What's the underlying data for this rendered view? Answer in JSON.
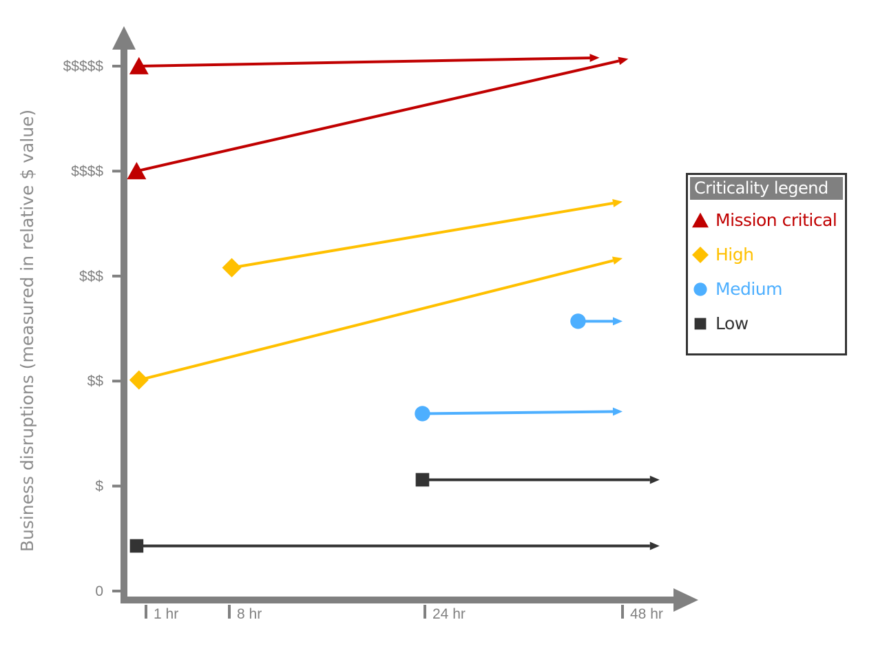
{
  "chart_data": {
    "type": "line",
    "ylabel": "Business disruptions (measured in relative $ value)",
    "x_ticks": [
      {
        "label": "1 hr",
        "value": 1
      },
      {
        "label": "8 hr",
        "value": 8
      },
      {
        "label": "24 hr",
        "value": 24
      },
      {
        "label": "48 hr",
        "value": 48
      }
    ],
    "y_ticks": [
      {
        "label": "0",
        "value": 0
      },
      {
        "label": "$",
        "value": 1
      },
      {
        "label": "$$",
        "value": 2
      },
      {
        "label": "$$$",
        "value": 3
      },
      {
        "label": "$$$$",
        "value": 4
      },
      {
        "label": "$$$$$",
        "value": 5
      }
    ],
    "series": [
      {
        "category": "mission",
        "start": [
          0.7,
          5.0
        ],
        "end": [
          45.2,
          5.08
        ]
      },
      {
        "category": "mission",
        "start": [
          0.6,
          4.0
        ],
        "end": [
          48.7,
          5.07
        ]
      },
      {
        "category": "high",
        "start": [
          8.2,
          3.08
        ],
        "end": [
          48,
          3.71
        ]
      },
      {
        "category": "high",
        "start": [
          0.7,
          2.01
        ],
        "end": [
          48,
          3.17
        ]
      },
      {
        "category": "medium",
        "start": [
          42.6,
          2.57
        ],
        "end": [
          48,
          2.57
        ]
      },
      {
        "category": "medium",
        "start": [
          23.8,
          1.69
        ],
        "end": [
          48,
          1.71
        ]
      },
      {
        "category": "low",
        "start": [
          23.8,
          1.06
        ],
        "end": [
          52.5,
          1.06
        ]
      },
      {
        "category": "low",
        "start": [
          0.6,
          0.43
        ],
        "end": [
          52.5,
          0.43
        ]
      }
    ]
  },
  "legend": {
    "title": "Criticality legend",
    "items": [
      {
        "key": "mission",
        "label": "Mission critical",
        "marker": "triangle",
        "color": "#c00000"
      },
      {
        "key": "high",
        "label": "High",
        "marker": "diamond",
        "color": "#ffc000"
      },
      {
        "key": "medium",
        "label": "Medium",
        "marker": "circle",
        "color": "#4dafff"
      },
      {
        "key": "low",
        "label": "Low",
        "marker": "square",
        "color": "#333333"
      }
    ]
  },
  "colors": {
    "axis": "#808080"
  }
}
